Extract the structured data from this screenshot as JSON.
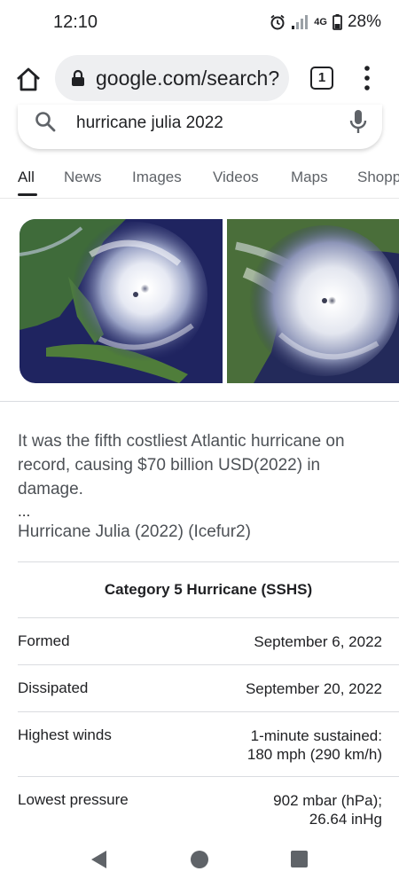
{
  "status_bar": {
    "time": "12:10",
    "network": "4G",
    "battery": "28%",
    "icons": [
      "alarm-icon",
      "signal-icon",
      "network-4g-icon",
      "battery-icon"
    ]
  },
  "browser": {
    "url": "google.com/search?",
    "tab_count": "1",
    "icons": [
      "home-icon",
      "lock-icon",
      "tabs-icon",
      "more-vert-icon"
    ]
  },
  "search": {
    "query": "hurricane julia 2022"
  },
  "tabs": [
    "All",
    "News",
    "Images",
    "Videos",
    "Maps",
    "Shopping"
  ],
  "snippet": {
    "text": "It was the fifth costliest Atlantic hurricane on record, causing $70 billion USD(2022) in damage.",
    "ellipsis": "...",
    "source": "Hurricane Julia (2022) (Icefur2)"
  },
  "infobox": {
    "header": "Category 5 Hurricane (SSHS)",
    "rows": [
      {
        "label": "Formed",
        "value_lines": [
          "September 6, 2022"
        ]
      },
      {
        "label": "Dissipated",
        "value_lines": [
          "September 20, 2022"
        ]
      },
      {
        "label": "Highest winds",
        "value_lines": [
          "1-minute sustained:",
          "180 mph (290 km/h)"
        ]
      },
      {
        "label": "Lowest pressure",
        "value_lines": [
          "902 mbar (hPa);",
          "26.64 inHg"
        ]
      }
    ]
  },
  "colors": {
    "text_primary": "#202124",
    "text_secondary": "#5f6368",
    "snippet_text": "#4d5156",
    "url_pill_bg": "#eeeff1",
    "divider": "#dadce0"
  }
}
